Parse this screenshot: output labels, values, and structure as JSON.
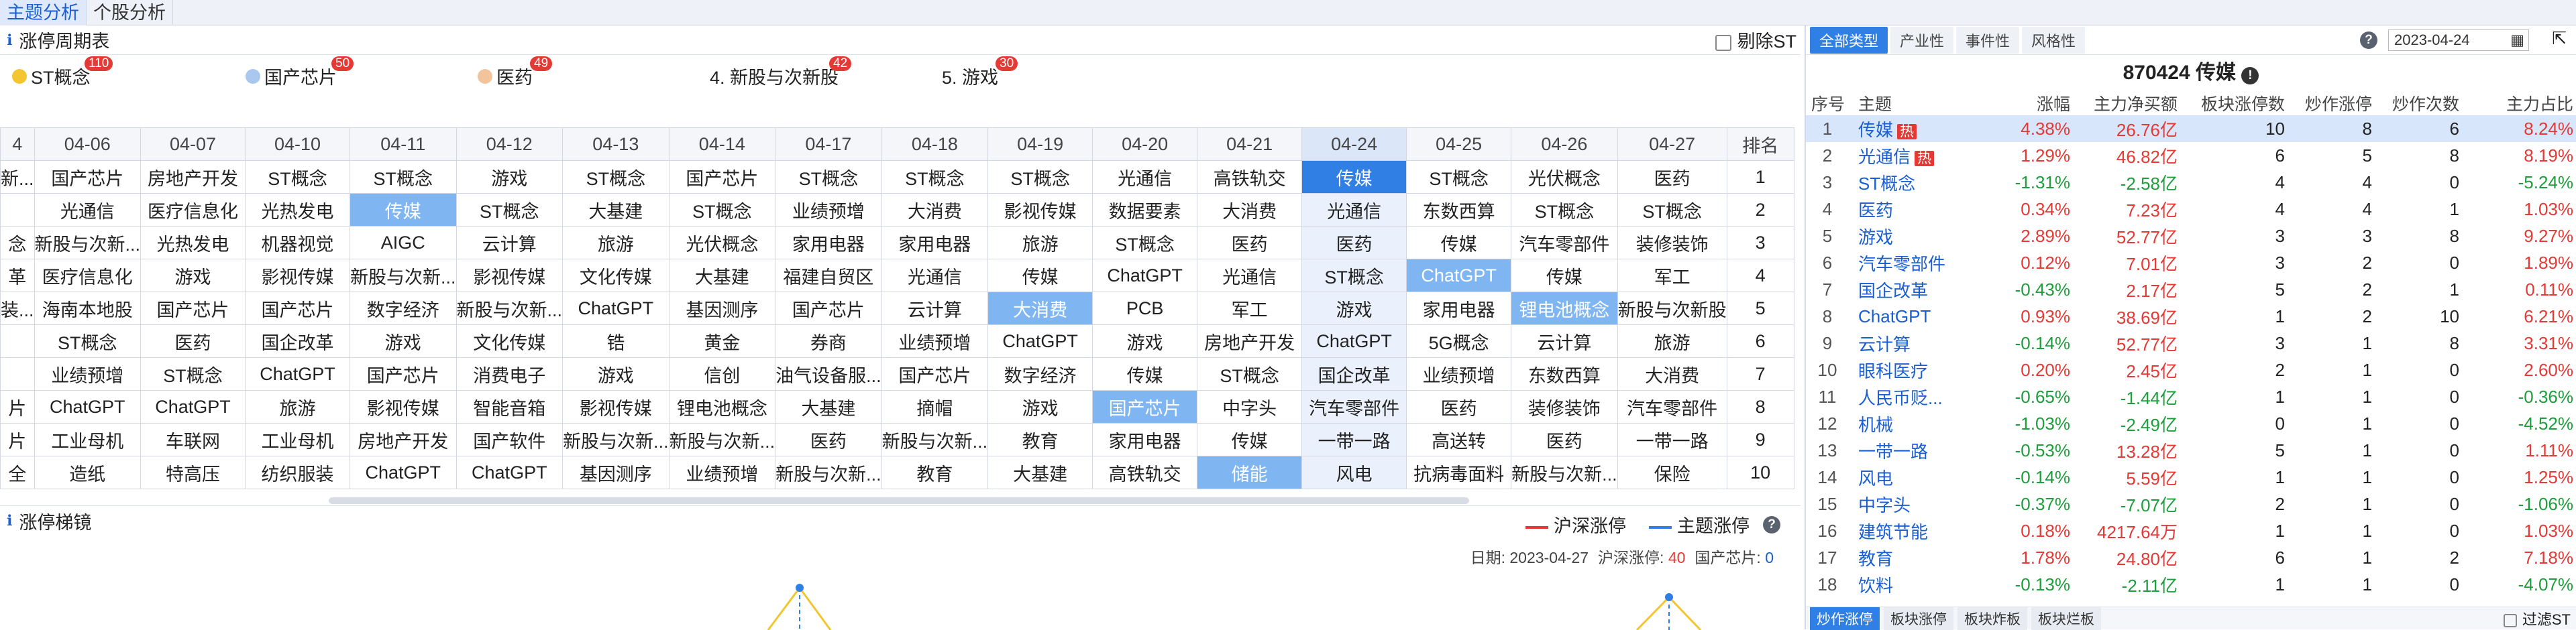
{
  "nav": {
    "tabs": [
      "主题分析",
      "个股分析"
    ]
  },
  "cycle": {
    "title": "涨停周期表",
    "exclude_st": "剔除ST",
    "legend": [
      {
        "label": "ST概念",
        "count": "110",
        "color": "#f2c531"
      },
      {
        "label": "国产芯片",
        "count": "50",
        "color": "#a9c7ef"
      },
      {
        "label": "医药",
        "count": "49",
        "color": "#f1c49c"
      },
      {
        "label": "4. 新股与次新股",
        "count": "42"
      },
      {
        "label": "5. 游戏",
        "count": "30"
      }
    ],
    "headers": [
      "4",
      "04-06",
      "04-07",
      "04-10",
      "04-11",
      "04-12",
      "04-13",
      "04-14",
      "04-17",
      "04-18",
      "04-19",
      "04-20",
      "04-21",
      "04-24",
      "04-25",
      "04-26",
      "04-27",
      "排名"
    ],
    "rows": [
      [
        "新...",
        "国产芯片",
        "房地产开发",
        "ST概念",
        "ST概念",
        "游戏",
        "ST概念",
        "国产芯片",
        "ST概念",
        "ST概念",
        "ST概念",
        "光通信",
        "高铁轨交",
        "传媒",
        "ST概念",
        "光伏概念",
        "医药",
        "1"
      ],
      [
        "",
        "光通信",
        "医疗信息化",
        "光热发电",
        "传媒",
        "ST概念",
        "大基建",
        "ST概念",
        "业绩预增",
        "大消费",
        "影视传媒",
        "数据要素",
        "大消费",
        "光通信",
        "东数西算",
        "ST概念",
        "ST概念",
        "2"
      ],
      [
        "念",
        "新股与次新...",
        "光热发电",
        "机器视觉",
        "AIGC",
        "云计算",
        "旅游",
        "光伏概念",
        "家用电器",
        "家用电器",
        "旅游",
        "ST概念",
        "医药",
        "医药",
        "传媒",
        "汽车零部件",
        "装修装饰",
        "3"
      ],
      [
        "革",
        "医疗信息化",
        "游戏",
        "影视传媒",
        "新股与次新...",
        "影视传媒",
        "文化传媒",
        "大基建",
        "福建自贸区",
        "光通信",
        "传媒",
        "ChatGPT",
        "光通信",
        "ST概念",
        "ChatGPT",
        "传媒",
        "军工",
        "4"
      ],
      [
        "装...",
        "海南本地股",
        "国产芯片",
        "国产芯片",
        "数字经济",
        "新股与次新...",
        "ChatGPT",
        "基因测序",
        "国产芯片",
        "云计算",
        "大消费",
        "PCB",
        "军工",
        "游戏",
        "家用电器",
        "锂电池概念",
        "新股与次新股",
        "5"
      ],
      [
        "",
        "ST概念",
        "医药",
        "国企改革",
        "游戏",
        "文化传媒",
        "锆",
        "黄金",
        "券商",
        "业绩预增",
        "ChatGPT",
        "游戏",
        "房地产开发",
        "ChatGPT",
        "5G概念",
        "云计算",
        "旅游",
        "6"
      ],
      [
        "",
        "业绩预增",
        "ST概念",
        "ChatGPT",
        "国产芯片",
        "消费电子",
        "游戏",
        "信创",
        "油气设备服...",
        "国产芯片",
        "数字经济",
        "传媒",
        "ST概念",
        "国企改革",
        "业绩预增",
        "东数西算",
        "大消费",
        "7"
      ],
      [
        "片",
        "ChatGPT",
        "ChatGPT",
        "旅游",
        "影视传媒",
        "智能音箱",
        "影视传媒",
        "锂电池概念",
        "大基建",
        "摘帽",
        "游戏",
        "国产芯片",
        "中字头",
        "汽车零部件",
        "医药",
        "装修装饰",
        "汽车零部件",
        "8"
      ],
      [
        "片",
        "工业母机",
        "车联网",
        "工业母机",
        "房地产开发",
        "国产软件",
        "新股与次新...",
        "新股与次新...",
        "医药",
        "新股与次新...",
        "教育",
        "家用电器",
        "传媒",
        "一带一路",
        "高送转",
        "医药",
        "一带一路",
        "9"
      ],
      [
        "全",
        "造纸",
        "特高压",
        "纺织服装",
        "ChatGPT",
        "ChatGPT",
        "基因测序",
        "业绩预增",
        "新股与次新...",
        "教育",
        "大基建",
        "高铁轨交",
        "储能",
        "风电",
        "抗病毒面料",
        "新股与次新...",
        "保险",
        "10"
      ]
    ]
  },
  "ladder": {
    "title": "涨停梯镜",
    "legend_a": "沪深涨停",
    "legend_b": "主题涨停",
    "color_a": "#e53935",
    "color_b": "#2f7fe5",
    "date_label": "日期:",
    "date": "2023-04-27",
    "hs_label": "沪深涨停:",
    "hs_value": "40",
    "theme_label": "国产芯片:",
    "theme_value": "0"
  },
  "right": {
    "tabs": [
      "全部类型",
      "产业性",
      "事件性",
      "风格性"
    ],
    "date": "2023-04-24",
    "title": "870424 传媒",
    "headers": [
      "序号",
      "主题",
      "涨幅",
      "主力净买额",
      "板块涨停数",
      "炒作涨停",
      "炒作次数",
      "主力占比"
    ],
    "rows": [
      [
        "1",
        "传媒",
        "4.38%",
        "26.76亿",
        "10",
        "8",
        "6",
        "8.24%"
      ],
      [
        "2",
        "光通信",
        "1.29%",
        "46.82亿",
        "6",
        "5",
        "8",
        "8.19%"
      ],
      [
        "3",
        "ST概念",
        "-1.31%",
        "-2.58亿",
        "4",
        "4",
        "0",
        "-5.24%"
      ],
      [
        "4",
        "医药",
        "0.34%",
        "7.23亿",
        "4",
        "4",
        "1",
        "1.03%"
      ],
      [
        "5",
        "游戏",
        "2.89%",
        "52.77亿",
        "3",
        "3",
        "8",
        "9.27%"
      ],
      [
        "6",
        "汽车零部件",
        "0.12%",
        "7.01亿",
        "3",
        "2",
        "0",
        "1.89%"
      ],
      [
        "7",
        "国企改革",
        "-0.43%",
        "2.17亿",
        "5",
        "2",
        "1",
        "0.11%"
      ],
      [
        "8",
        "ChatGPT",
        "0.93%",
        "38.69亿",
        "1",
        "2",
        "10",
        "6.21%"
      ],
      [
        "9",
        "云计算",
        "-0.14%",
        "52.77亿",
        "3",
        "1",
        "8",
        "3.31%"
      ],
      [
        "10",
        "眼科医疗",
        "0.20%",
        "2.45亿",
        "2",
        "1",
        "0",
        "2.60%"
      ],
      [
        "11",
        "人民币贬...",
        "-0.65%",
        "-1.44亿",
        "1",
        "1",
        "0",
        "-0.36%"
      ],
      [
        "12",
        "机械",
        "-1.03%",
        "-2.49亿",
        "0",
        "1",
        "0",
        "-4.52%"
      ],
      [
        "13",
        "一带一路",
        "-0.53%",
        "13.28亿",
        "5",
        "1",
        "0",
        "1.11%"
      ],
      [
        "14",
        "风电",
        "-0.14%",
        "5.59亿",
        "1",
        "1",
        "0",
        "1.25%"
      ],
      [
        "15",
        "中字头",
        "-0.37%",
        "-7.07亿",
        "2",
        "1",
        "0",
        "-1.06%"
      ],
      [
        "16",
        "建筑节能",
        "0.18%",
        "4217.64万",
        "1",
        "1",
        "0",
        "1.03%"
      ],
      [
        "17",
        "教育",
        "1.78%",
        "24.80亿",
        "6",
        "1",
        "2",
        "7.18%"
      ],
      [
        "18",
        "饮料",
        "-0.13%",
        "-2.11亿",
        "1",
        "1",
        "0",
        "-4.07%"
      ]
    ],
    "hot_label": "热",
    "bottom_tabs": [
      "炒作涨停",
      "板块涨停",
      "板块炸板",
      "板块烂板"
    ],
    "filter_st": "过滤ST"
  }
}
